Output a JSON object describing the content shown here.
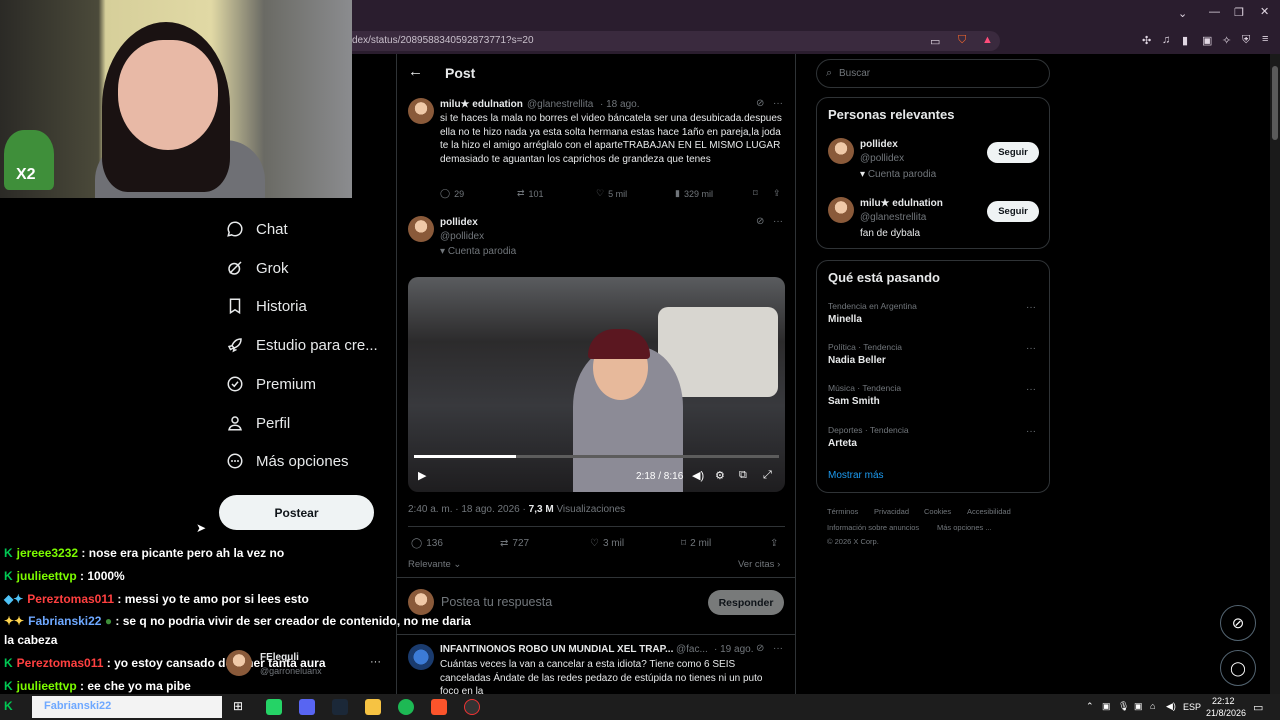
{
  "browser": {
    "url": "dex/status/2089588340592873771?s=20"
  },
  "webcam": {
    "badge": "X2"
  },
  "nav": [
    {
      "label": "Chat",
      "icon": "chat-icon"
    },
    {
      "label": "Grok",
      "icon": "grok-icon"
    },
    {
      "label": "Historia",
      "icon": "bookmark-icon"
    },
    {
      "label": "Estudio para cre...",
      "icon": "rocket-icon"
    },
    {
      "label": "Premium",
      "icon": "verified-icon"
    },
    {
      "label": "Perfil",
      "icon": "person-icon"
    },
    {
      "label": "Más opciones",
      "icon": "more-circle-icon"
    }
  ],
  "post_button": "Postear",
  "chat": [
    {
      "user": "jereee3232",
      "color": "#7cfc00",
      "message": ": nose era picante pero ah la vez no"
    },
    {
      "user": "juulieettvp",
      "color": "#7cfc00",
      "message": ": 1000%"
    },
    {
      "user": "Pereztomas011",
      "color": "#ff4040",
      "message": ": messi yo te amo por si lees esto"
    },
    {
      "user": "Fabrianski22",
      "color": "#6ea8ff",
      "message": ": se q no podria vivir de ser creador de contenido, no me daria"
    },
    {
      "user": "",
      "color": "#ffffff",
      "message": "la cabeza"
    },
    {
      "user": "Pereztomas011",
      "color": "#ff4040",
      "message": ": yo estoy cansado de tener tanta aura"
    },
    {
      "user": "juulieettvp",
      "color": "#7cfc00",
      "message": ": ee che yo ma pibe"
    }
  ],
  "chat_overlay": {
    "name": "FEleguli",
    "handle": "@garroneluanx"
  },
  "post": {
    "header": "Post",
    "reply_tweet": {
      "name": "milu★ edulnation",
      "handle": "@glanestrellita",
      "date": "· 18 ago.",
      "text": "si te haces la mala no borres el video báncatela ser una desubicada.despues ella no te hizo nada ya esta solta hermana estas hace 1año en pareja,la joda te la hizo el amigo arréglalo con el aparteTRABAJAN EN EL MISMO LUGAR demasiado te aguantan los caprichos de grandeza que tenes",
      "replies": "29",
      "reposts": "101",
      "likes": "5 mil",
      "views": "329 mil"
    },
    "main_tweet": {
      "name": "pollidex",
      "handle": "@pollidex",
      "badge": "Cuenta parodia",
      "video_time": "2:18 / 8:16",
      "video_progress": 0.28,
      "timestamp": "2:40 a. m. · 18 ago. 2026 ·",
      "views_count": "7,3 M",
      "views_label": "Visualizaciones",
      "replies": "136",
      "reposts": "727",
      "likes": "3 mil",
      "bookmarks": "2 mil"
    },
    "sort_label": "Relevante",
    "quotes_label": "Ver citas",
    "reply_placeholder": "Postea tu respuesta",
    "reply_button": "Responder",
    "next_tweet": {
      "name": "INFANTINONOS ROBO UN MUNDIAL XEL TRAP...",
      "handle": "@fac...",
      "date": "· 19 ago.",
      "text": "Cuántas veces la van a cancelar a esta idiota? Tiene como 6 SEIS canceladas Ándate de las redes pedazo de estúpida no tienes ni un puto foco en la"
    }
  },
  "sidebar": {
    "search_placeholder": "Buscar",
    "relevant_title": "Personas relevantes",
    "people": [
      {
        "name": "pollidex",
        "handle": "@pollidex",
        "bio": "Cuenta parodia",
        "button": "Seguir"
      },
      {
        "name": "milu★ edulnation",
        "handle": "@glanestrellita",
        "bio": "fan de dybala",
        "button": "Seguir"
      }
    ],
    "trending_title": "Qué está pasando",
    "trends": [
      {
        "category": "Tendencia en Argentina",
        "name": "Minella"
      },
      {
        "category": "Política · Tendencia",
        "name": "Nadia Beller"
      },
      {
        "category": "Música · Tendencia",
        "name": "Sam Smith"
      },
      {
        "category": "Deportes · Tendencia",
        "name": "Arteta"
      }
    ],
    "show_more": "Mostrar más",
    "footer_line1": [
      "Términos",
      "Privacidad",
      "Cookies",
      "Accesibilidad"
    ],
    "footer_line2": [
      "Información sobre anuncios",
      "Más opciones ..."
    ],
    "copyright": "© 2026 X Corp."
  },
  "taskbar": {
    "lang": "ESP",
    "time": "22:12",
    "date": "21/8/2026",
    "search_user": "Fabrianski22"
  }
}
